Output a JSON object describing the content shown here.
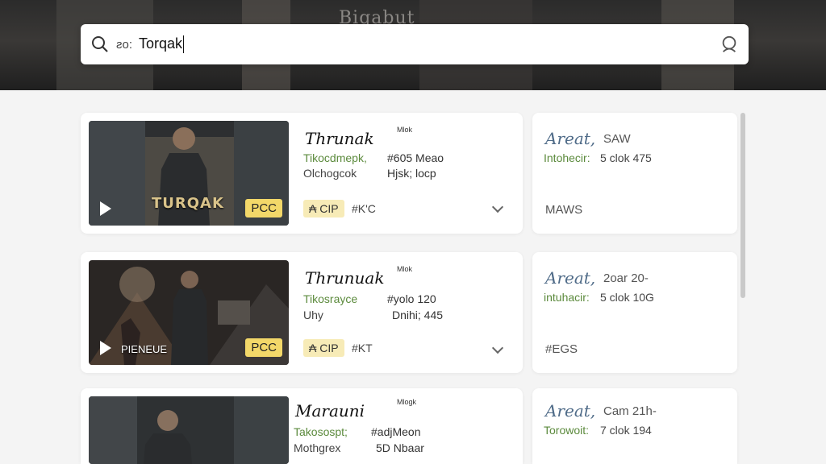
{
  "header": {
    "background_title": "Biqabut"
  },
  "search": {
    "prefix": "ƨo:",
    "value": "Torqak"
  },
  "results": [
    {
      "thumb_label": "TURQAK",
      "play_label": "",
      "badge": "PCC",
      "title": "Thrunak",
      "title_small": "Mlok",
      "genre": "Tikocdmepk,",
      "meta1": "#605 Meao",
      "sub": "Olchogcok",
      "meta2": "Hjsk; locp",
      "tag": "₳ CIP",
      "hashtag": "#K'C",
      "side": {
        "title": "Areat,",
        "sub": "SAW",
        "label": "Intohecir:",
        "value": "5 clok 475",
        "footer": "MAWS"
      }
    },
    {
      "thumb_label": "",
      "play_label": "PIENEUE",
      "badge": "PCC",
      "title": "Thrunuak",
      "title_small": "Mlok",
      "genre": "Tikosrayce",
      "meta1": "#yolo 120",
      "sub": "Uhy",
      "meta2": "Dnihi; 445",
      "tag": "₳ CIP",
      "hashtag": "#KT",
      "side": {
        "title": "Areat,",
        "sub": "2oar 20-",
        "label": "intuhacir:",
        "value": "5 clok 10G",
        "footer": "#EGS"
      }
    },
    {
      "thumb_label": "",
      "play_label": "",
      "badge": "",
      "title": "Marauni",
      "title_small": "Mlogk",
      "genre": "Takosospt;",
      "meta1": "#adjMeon",
      "sub": "Mothgrex",
      "meta2": "5D Nbaar",
      "tag": "",
      "hashtag": "",
      "side": {
        "title": "Areat,",
        "sub": "Cam 21h-",
        "label": "Torowoit:",
        "value": "7 clok 194",
        "footer": ""
      }
    }
  ],
  "colors": {
    "badge": "#f3d869",
    "tag": "#f7ebb7",
    "green": "#5b8a3c",
    "side_title": "#4f6b88"
  },
  "icons": [
    "search-icon",
    "user-search-icon",
    "play-icon",
    "chevron-down-icon"
  ]
}
